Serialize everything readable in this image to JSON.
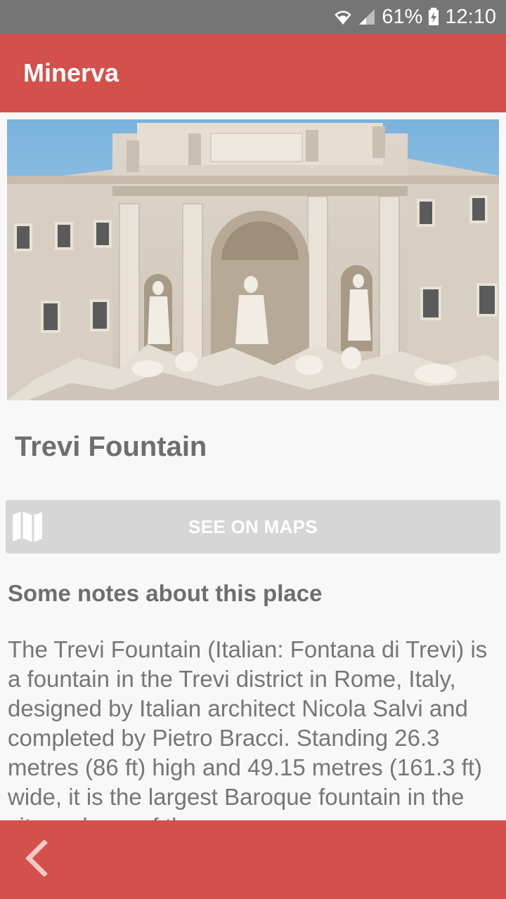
{
  "status_bar": {
    "battery": "61%",
    "time": "12:10",
    "icons": [
      "wifi-icon",
      "cell-signal-icon",
      "battery-charging-icon"
    ]
  },
  "app_bar": {
    "title": "Minerva"
  },
  "place": {
    "image_icon": "trevi-fountain-photo",
    "title": "Trevi Fountain",
    "maps_button": {
      "label": "SEE ON MAPS",
      "icon": "map-icon"
    },
    "notes_heading": "Some notes about this place",
    "description": "The Trevi Fountain (Italian: Fontana di Trevi) is a fountain in the Trevi district in Rome, Italy, designed by Italian architect Nicola Salvi and completed by Pietro Bracci. Standing 26.3 metres (86 ft) high and 49.15 metres (161.3 ft) wide, it is the largest Baroque fountain in the city and one of the"
  },
  "bottom_bar": {
    "back_icon": "chevron-left-icon"
  },
  "colors": {
    "accent": "#d4504b",
    "status_bar": "#757575",
    "button_bg": "#d6d6d6",
    "text_gray": "#6e6e6e"
  }
}
